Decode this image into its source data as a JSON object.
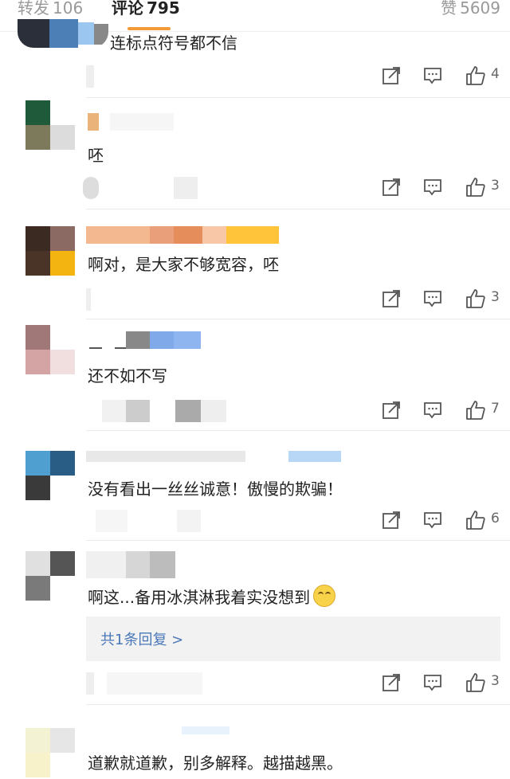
{
  "tabs": {
    "repost": {
      "label": "转发",
      "count": "106"
    },
    "comment": {
      "label": "评论",
      "count": "795"
    },
    "like": {
      "label": "赞",
      "count": "5609"
    }
  },
  "comments": [
    {
      "text": "连标点符号都不信",
      "likes": "4"
    },
    {
      "text": "呸",
      "likes": "3"
    },
    {
      "text": "啊对，是大家不够宽容，呸",
      "likes": "3"
    },
    {
      "text": "还不如不写",
      "likes": "7"
    },
    {
      "text": "没有看出一丝丝诚意！傲慢的欺骗！",
      "likes": "6"
    },
    {
      "text": "啊这...备用冰淇淋我着实没想到",
      "likes": "3",
      "reply_link": "共1条回复 >"
    },
    {
      "text": "道歉就道歉，别多解释。越描越黑。"
    }
  ],
  "icons": {
    "share": "share-icon",
    "comment": "comment-icon",
    "like": "thumb-up-icon",
    "emoji": "smile-emoji"
  },
  "colors": {
    "accent": "#f29a38",
    "link": "#4a78b8",
    "divider": "#e9e9e9"
  }
}
